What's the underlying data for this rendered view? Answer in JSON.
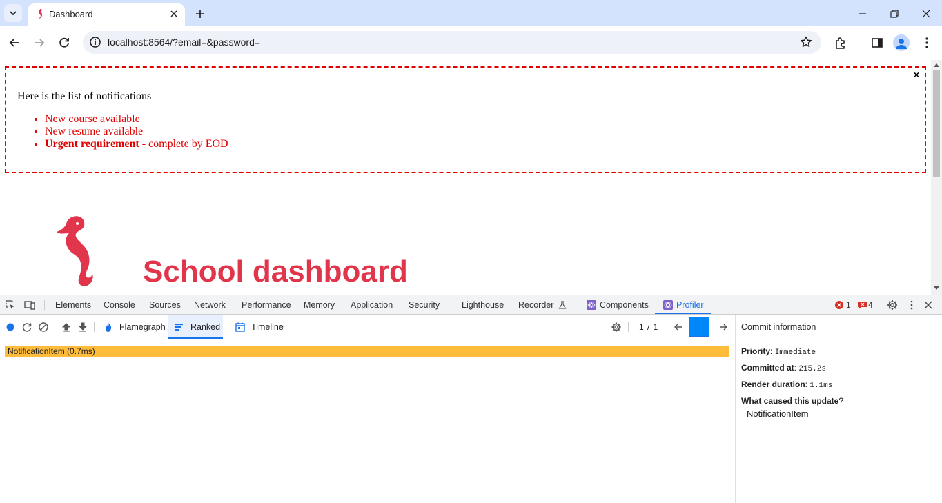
{
  "browser": {
    "tab_title": "Dashboard",
    "url": "localhost:8564/?email=&password="
  },
  "page": {
    "notifications": {
      "close_label": "×",
      "intro": "Here is the list of notifications",
      "items": [
        {
          "text": "New course available"
        },
        {
          "text": "New resume available"
        },
        {
          "strong": "Urgent requirement",
          "text": " - complete by EOD"
        }
      ]
    },
    "title": "School dashboard",
    "colors": {
      "accent": "#e1354b",
      "notification_red": "#e00000"
    }
  },
  "devtools": {
    "tabs": [
      "Elements",
      "Console",
      "Sources",
      "Network",
      "Performance",
      "Memory",
      "Application",
      "Security",
      "Lighthouse",
      "Recorder",
      "Components",
      "Profiler"
    ],
    "active_tab": "Profiler",
    "errors": "1",
    "issues": "4",
    "profiler": {
      "tabs": [
        "Flamegraph",
        "Ranked",
        "Timeline"
      ],
      "active_tab": "Ranked",
      "commit_counter": "1 / 1",
      "ranked_item": "NotificationItem (0.7ms)",
      "commit_info": {
        "header": "Commit information",
        "priority_label": "Priority",
        "priority_value": "Immediate",
        "committed_label": "Committed at",
        "committed_value": "215.2s",
        "render_label": "Render duration",
        "render_value": "1.1ms",
        "cause_label": "What caused this update",
        "cause_item": "NotificationItem"
      }
    }
  }
}
